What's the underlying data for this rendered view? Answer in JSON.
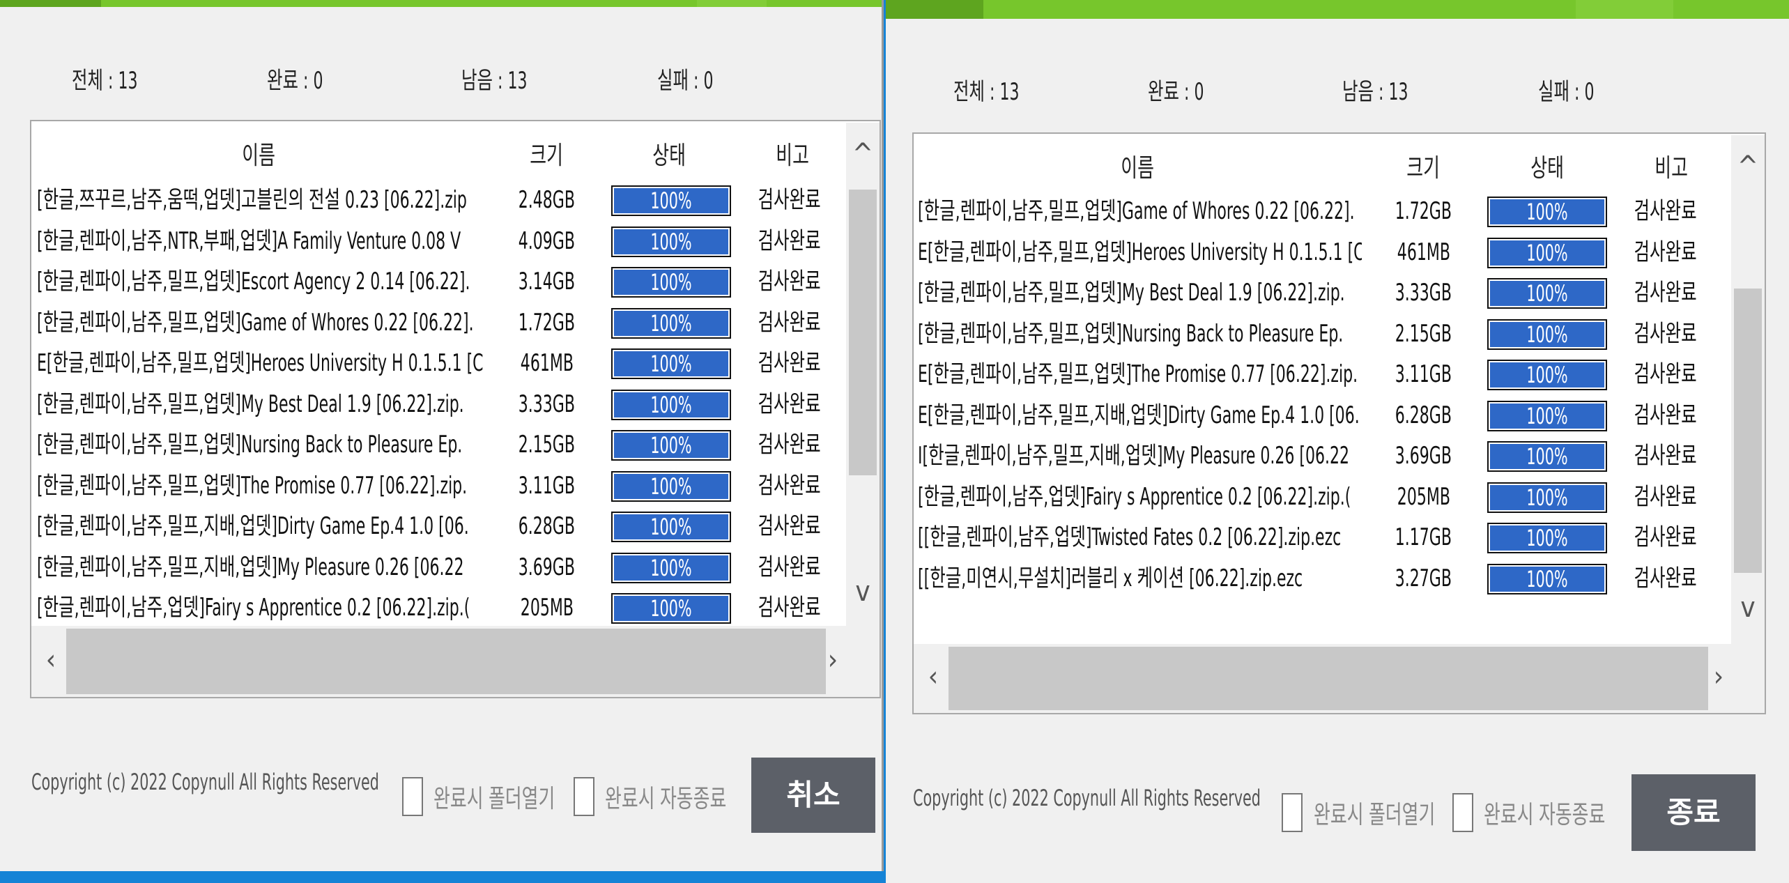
{
  "windows": [
    {
      "stats": {
        "total": "전체 : 13",
        "done": "완료 : 0",
        "remaining": "남음 : 13",
        "failed": "실패 : 0"
      },
      "columns": {
        "name": "이름",
        "size": "크기",
        "status": "상태",
        "note": "비고"
      },
      "rows": [
        {
          "name": "[한글,쯔꾸르,남주,움떡,업뎃]고블린의 전설 0.23 [06.22].zip",
          "size": "2.48GB",
          "progress": 100,
          "status": "100%",
          "note": "검사완료"
        },
        {
          "name": "[한글,렌파이,남주,NTR,부패,업뎃]A Family Venture 0.08 V",
          "size": "4.09GB",
          "progress": 100,
          "status": "100%",
          "note": "검사완료"
        },
        {
          "name": "[한글,렌파이,남주,밀프,업뎃]Escort Agency 2 0.14 [06.22].",
          "size": "3.14GB",
          "progress": 100,
          "status": "100%",
          "note": "검사완료"
        },
        {
          "name": "[한글,렌파이,남주,밀프,업뎃]Game of Whores 0.22 [06.22].",
          "size": "1.72GB",
          "progress": 100,
          "status": "100%",
          "note": "검사완료"
        },
        {
          "name": "E[한글,렌파이,남주,밀프,업뎃]Heroes University H 0.1.5.1 [C",
          "size": "461MB",
          "progress": 100,
          "status": "100%",
          "note": "검사완료"
        },
        {
          "name": "[한글,렌파이,남주,밀프,업뎃]My Best Deal 1.9 [06.22].zip.",
          "size": "3.33GB",
          "progress": 100,
          "status": "100%",
          "note": "검사완료"
        },
        {
          "name": "[한글,렌파이,남주,밀프,업뎃]Nursing Back to Pleasure Ep.",
          "size": "2.15GB",
          "progress": 100,
          "status": "100%",
          "note": "검사완료"
        },
        {
          "name": "[한글,렌파이,남주,밀프,업뎃]The Promise 0.77 [06.22].zip.",
          "size": "3.11GB",
          "progress": 100,
          "status": "100%",
          "note": "검사완료"
        },
        {
          "name": "[한글,렌파이,남주,밀프,지배,업뎃]Dirty Game Ep.4 1.0 [06.",
          "size": "6.28GB",
          "progress": 100,
          "status": "100%",
          "note": "검사완료"
        },
        {
          "name": "[한글,렌파이,남주,밀프,지배,업뎃]My Pleasure 0.26 [06.22",
          "size": "3.69GB",
          "progress": 100,
          "status": "100%",
          "note": "검사완료"
        },
        {
          "name": "[한글,렌파이,남주,업뎃]Fairy s Apprentice 0.2 [06.22].zip.(",
          "size": "205MB",
          "progress": 100,
          "status": "100%",
          "note": "검사완료"
        }
      ],
      "footer": {
        "copyright": "Copyright (c) 2022 Copynull All Rights Reserved",
        "open_folder_label": "완료시 폴더열기",
        "auto_exit_label": "완료시 자동종료",
        "action_button": "취소"
      }
    },
    {
      "stats": {
        "total": "전체 : 13",
        "done": "완료 : 0",
        "remaining": "남음 : 13",
        "failed": "실패 : 0"
      },
      "columns": {
        "name": "이름",
        "size": "크기",
        "status": "상태",
        "note": "비고"
      },
      "rows": [
        {
          "name": "[한글,렌파이,남주,밀프,업뎃]Game of Whores 0.22 [06.22].",
          "size": "1.72GB",
          "progress": 100,
          "status": "100%",
          "note": "검사완료"
        },
        {
          "name": "E[한글,렌파이,남주,밀프,업뎃]Heroes University H 0.1.5.1 [C",
          "size": "461MB",
          "progress": 100,
          "status": "100%",
          "note": "검사완료"
        },
        {
          "name": "[한글,렌파이,남주,밀프,업뎃]My Best Deal 1.9 [06.22].zip.",
          "size": "3.33GB",
          "progress": 100,
          "status": "100%",
          "note": "검사완료"
        },
        {
          "name": "[한글,렌파이,남주,밀프,업뎃]Nursing Back to Pleasure Ep.",
          "size": "2.15GB",
          "progress": 100,
          "status": "100%",
          "note": "검사완료"
        },
        {
          "name": "E[한글,렌파이,남주,밀프,업뎃]The Promise 0.77 [06.22].zip.",
          "size": "3.11GB",
          "progress": 100,
          "status": "100%",
          "note": "검사완료"
        },
        {
          "name": "E[한글,렌파이,남주,밀프,지배,업뎃]Dirty Game Ep.4 1.0 [06.",
          "size": "6.28GB",
          "progress": 100,
          "status": "100%",
          "note": "검사완료"
        },
        {
          "name": "I[한글,렌파이,남주,밀프,지배,업뎃]My Pleasure 0.26 [06.22",
          "size": "3.69GB",
          "progress": 100,
          "status": "100%",
          "note": "검사완료"
        },
        {
          "name": "[한글,렌파이,남주,업뎃]Fairy s Apprentice 0.2 [06.22].zip.(",
          "size": "205MB",
          "progress": 100,
          "status": "100%",
          "note": "검사완료"
        },
        {
          "name": "[[한글,렌파이,남주,업뎃]Twisted Fates 0.2 [06.22].zip.ezc",
          "size": "1.17GB",
          "progress": 100,
          "status": "100%",
          "note": "검사완료"
        },
        {
          "name": "[[한글,미연시,무설치]러블리 x 케이션 [06.22].zip.ezc",
          "size": "3.27GB",
          "progress": 100,
          "status": "100%",
          "note": "검사완료"
        }
      ],
      "footer": {
        "copyright": "Copyright (c) 2022 Copynull All Rights Reserved",
        "open_folder_label": "완료시 폴더열기",
        "auto_exit_label": "완료시 자동종료",
        "action_button": "종료"
      }
    }
  ],
  "colors": {
    "titlebar_green": "#77c62c",
    "progress_blue": "#2e68c7",
    "desktop_blue": "#1583d6",
    "button_gray": "#5c6068"
  },
  "icons": {
    "scroll_up": "chevron-up-icon",
    "scroll_down": "chevron-down-icon",
    "scroll_left": "chevron-left-icon",
    "scroll_right": "chevron-right-icon"
  }
}
